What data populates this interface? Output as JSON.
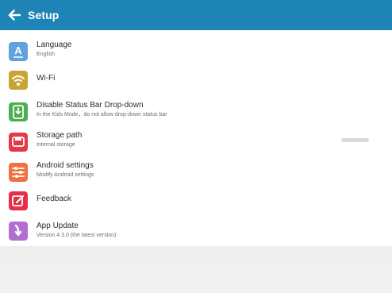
{
  "app_title": "Setup",
  "colors": {
    "app_bar": "#1e83b5",
    "background": "#ffffff",
    "footer_background": "#eeeeee"
  },
  "items": [
    {
      "label": "Language",
      "subtitle": "English",
      "icon": "language-icon",
      "icon_text": "A",
      "color": "#5fa2df"
    },
    {
      "label": "Wi-Fi",
      "subtitle": "",
      "icon": "wifi-icon",
      "color": "#c8a532"
    },
    {
      "label": "Disable Status Bar Drop-down",
      "subtitle": "In the Kids Mode，do not allow drop-down status bar",
      "icon": "status-bar-icon",
      "color": "#4caf50"
    },
    {
      "label": "Storage path",
      "subtitle": "Internal storage",
      "icon": "storage-icon",
      "color": "#e53947"
    },
    {
      "label": "Android settings",
      "subtitle": "Modify Android settings",
      "icon": "sliders-icon",
      "color": "#f07040"
    },
    {
      "label": "Feedback",
      "subtitle": "",
      "icon": "feedback-icon",
      "color": "#e5304a"
    },
    {
      "label": "App Update",
      "subtitle": "Version 4.3.0 (the latest version)",
      "icon": "app-update-icon",
      "color": "#b06ed1"
    }
  ]
}
